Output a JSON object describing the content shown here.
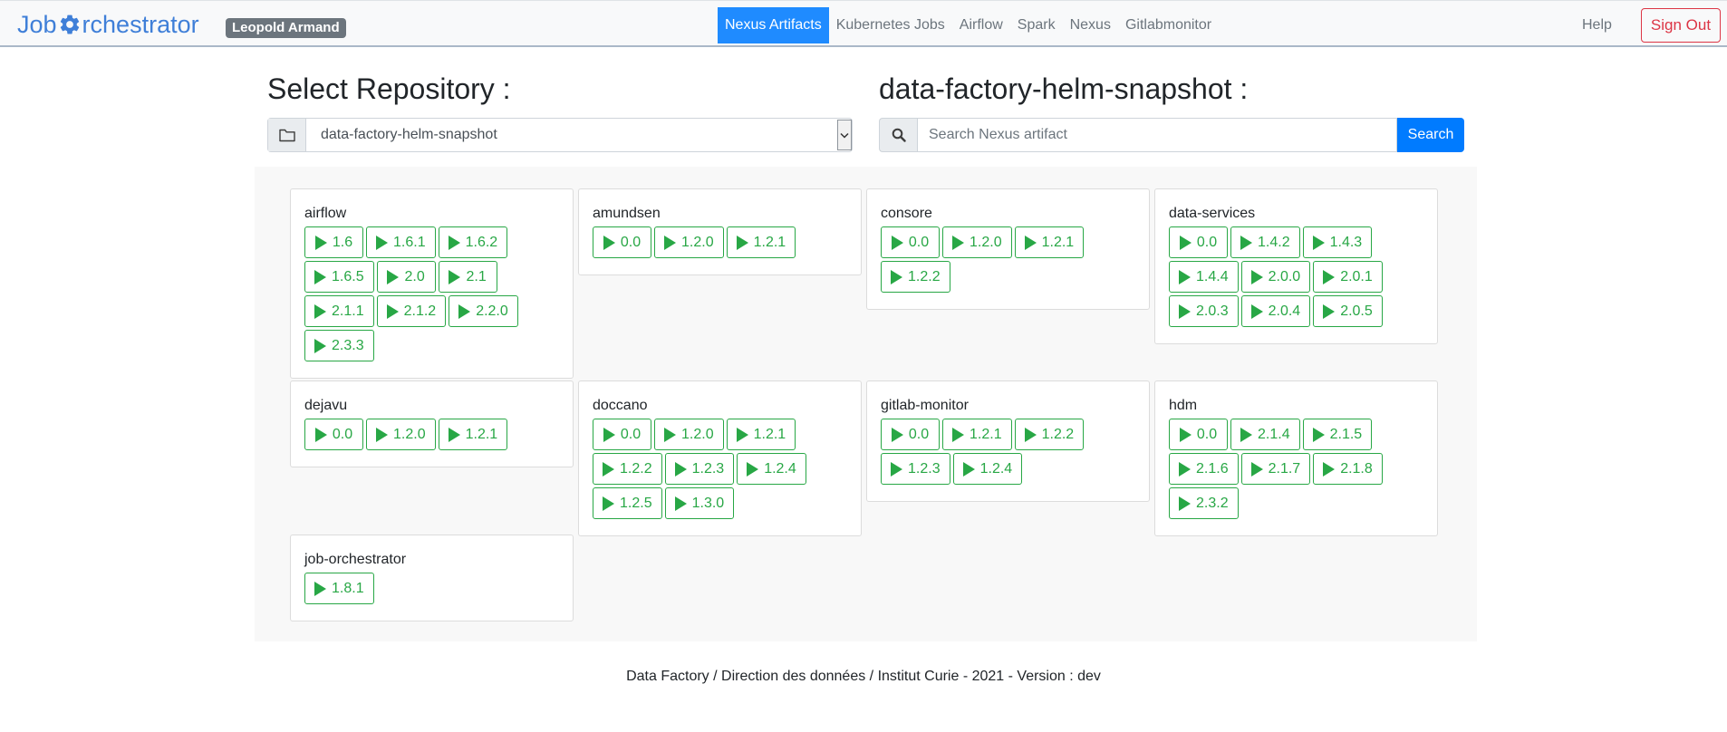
{
  "navbar": {
    "brand_before": "Job ",
    "brand_after": "rchestrator",
    "user": "Leopold Armand",
    "links": [
      "Nexus Artifacts",
      "Kubernetes Jobs",
      "Airflow",
      "Spark",
      "Nexus",
      "Gitlabmonitor"
    ],
    "active_link": "Nexus Artifacts",
    "help": "Help",
    "sign_out": "Sign Out",
    "brand_color": "#3f7fd8"
  },
  "select_section": {
    "heading": "Select Repository :",
    "selected": "data-factory-helm-snapshot"
  },
  "search_section": {
    "heading": "data-factory-helm-snapshot :",
    "placeholder": "Search Nexus artifact",
    "button": "Search"
  },
  "artifacts": [
    {
      "name": "airflow",
      "versions": [
        "1.6",
        "1.6.1",
        "1.6.2",
        "1.6.5",
        "2.0",
        "2.1",
        "2.1.1",
        "2.1.2",
        "2.2.0",
        "2.3.3"
      ]
    },
    {
      "name": "amundsen",
      "versions": [
        "0.0",
        "1.2.0",
        "1.2.1"
      ]
    },
    {
      "name": "consore",
      "versions": [
        "0.0",
        "1.2.0",
        "1.2.1",
        "1.2.2"
      ]
    },
    {
      "name": "data-services",
      "versions": [
        "0.0",
        "1.4.2",
        "1.4.3",
        "1.4.4",
        "2.0.0",
        "2.0.1",
        "2.0.3",
        "2.0.4",
        "2.0.5"
      ]
    },
    {
      "name": "dejavu",
      "versions": [
        "0.0",
        "1.2.0",
        "1.2.1"
      ]
    },
    {
      "name": "doccano",
      "versions": [
        "0.0",
        "1.2.0",
        "1.2.1",
        "1.2.2",
        "1.2.3",
        "1.2.4",
        "1.2.5",
        "1.3.0"
      ]
    },
    {
      "name": "gitlab-monitor",
      "versions": [
        "0.0",
        "1.2.1",
        "1.2.2",
        "1.2.3",
        "1.2.4"
      ]
    },
    {
      "name": "hdm",
      "versions": [
        "0.0",
        "2.1.4",
        "2.1.5",
        "2.1.6",
        "2.1.7",
        "2.1.8",
        "2.3.2"
      ]
    },
    {
      "name": "job-orchestrator",
      "versions": [
        "1.8.1"
      ]
    }
  ],
  "footer": "Data Factory / Direction des données / Institut Curie - 2021 - Version : dev",
  "colors": {
    "accent": "#007bff",
    "success": "#28a745",
    "danger": "#dc3545",
    "muted": "#6c757d"
  }
}
